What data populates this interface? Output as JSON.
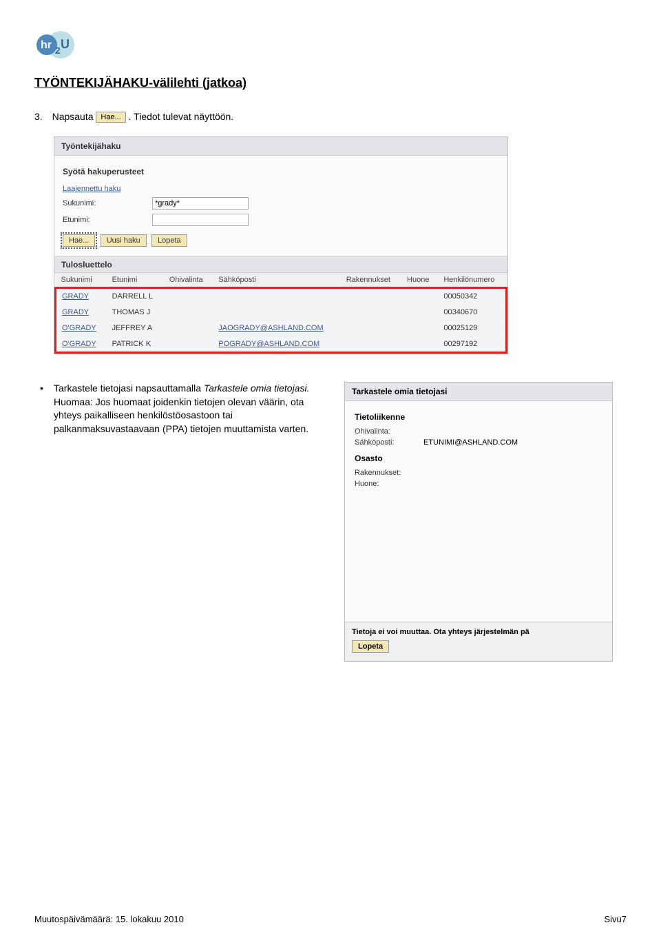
{
  "logo": {
    "text1": "hr",
    "text2": "2",
    "text3": "U"
  },
  "heading": "TYÖNTEKIJÄHAKU-välilehti (jatkoa)",
  "step": {
    "num": "3.",
    "before": "Napsauta ",
    "btn": "Hae...",
    "after": ". Tiedot tulevat näyttöön."
  },
  "s1": {
    "panelTitle": "Työntekijähaku",
    "subHead": "Syötä hakuperusteet",
    "advLink": "Laajennettu haku",
    "lblLast": "Sukunimi:",
    "lblFirst": "Etunimi:",
    "valLast": "*grady*",
    "valFirst": "",
    "btnHae": "Hae...",
    "btnUusi": "Uusi haku",
    "btnLopeta": "Lopeta",
    "resultsHead": "Tulosluettelo",
    "cols": [
      "Sukunimi",
      "Etunimi",
      "Ohivalinta",
      "Sähköposti",
      "Rakennukset",
      "Huone",
      "Henkilönumero"
    ],
    "rows": [
      {
        "last": "GRADY",
        "first": "DARRELL L",
        "dial": "",
        "email": "",
        "bld": "",
        "room": "",
        "num": "00050342"
      },
      {
        "last": "GRADY",
        "first": "THOMAS J",
        "dial": "",
        "email": "",
        "bld": "",
        "room": "",
        "num": "00340670"
      },
      {
        "last": "O'GRADY",
        "first": "JEFFREY A",
        "dial": "",
        "email": "JAOGRADY@ASHLAND.COM",
        "bld": "",
        "room": "",
        "num": "00025129"
      },
      {
        "last": "O'GRADY",
        "first": "PATRICK K",
        "dial": "",
        "email": "POGRADY@ASHLAND.COM",
        "bld": "",
        "room": "",
        "num": "00297192"
      }
    ]
  },
  "bullet": {
    "part1": "Tarkastele tietojasi napsauttamalla ",
    "italic": "Tarkastele omia tietojasi.",
    "part2": " Huomaa: Jos huomaat joidenkin tietojen olevan väärin, ota yhteys paikalliseen henkilöstöosastoon tai palkanmaksuvastaavaan (PPA) tietojen muuttamista varten."
  },
  "s2": {
    "panelTitle": "Tarkastele omia tietojasi",
    "sub1": "Tietoliikenne",
    "lblDial": "Ohivalinta:",
    "valDial": "",
    "lblEmail": "Sähköposti:",
    "valEmail": "ETUNIMI@ASHLAND.COM",
    "sub2": "Osasto",
    "lblBld": "Rakennukset:",
    "valBld": "",
    "lblRoom": "Huone:",
    "valRoom": "",
    "footerMsg": "Tietoja ei voi muuttaa. Ota yhteys järjestelmän pä",
    "btnLopeta": "Lopeta"
  },
  "footer": {
    "left": "Muutospäivämäärä: 15. lokakuu 2010",
    "right": "Sivu7"
  }
}
